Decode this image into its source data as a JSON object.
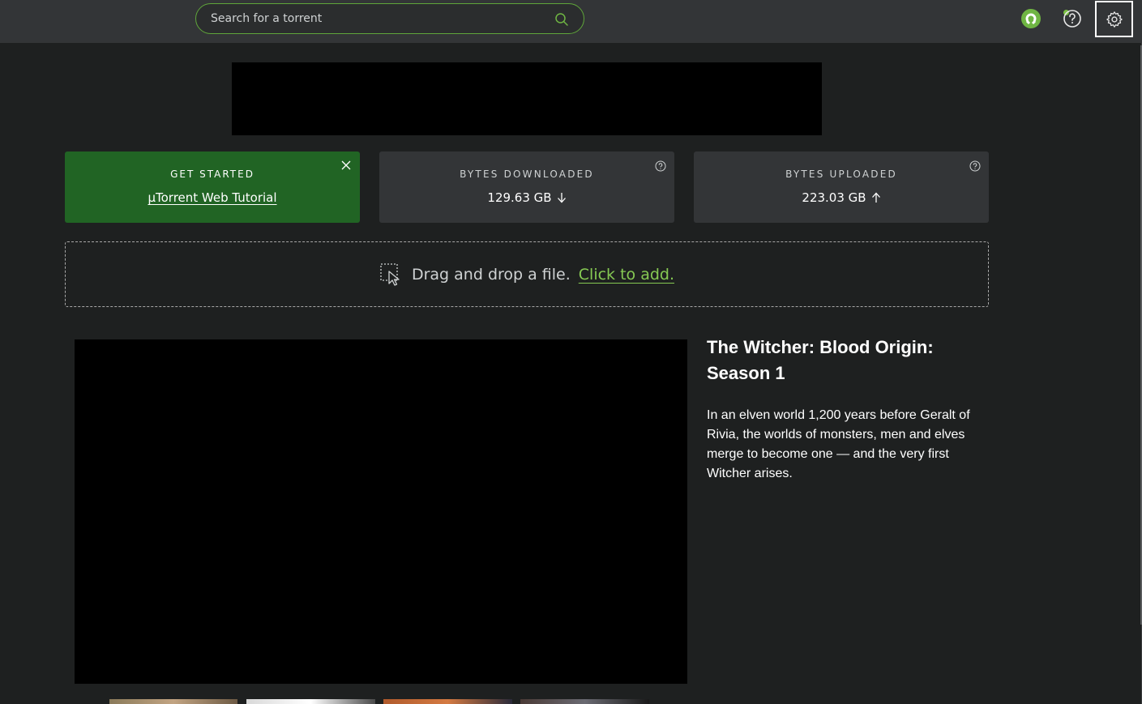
{
  "search": {
    "placeholder": "Search for a torrent"
  },
  "header": {
    "icons": [
      "magnet-icon",
      "help-icon",
      "settings-icon"
    ],
    "accent_color": "#7bc043"
  },
  "cards": {
    "get_started": {
      "label": "GET STARTED",
      "link": "µTorrent Web Tutorial"
    },
    "downloaded": {
      "label": "BYTES DOWNLOADED",
      "value": "129.63 GB"
    },
    "uploaded": {
      "label": "BYTES UPLOADED",
      "value": "223.03 GB"
    }
  },
  "dropzone": {
    "text": "Drag and drop a file.",
    "link": "Click to add."
  },
  "featured": {
    "title": "The Witcher: Blood Origin: Season 1",
    "description": "In an elven world 1,200 years before Geralt of Rivia, the worlds of monsters, men and elves merge to become one — and the very first Witcher arises."
  },
  "colors": {
    "brand_green": "#216424",
    "link_green": "#86c953",
    "panel": "#333537",
    "background": "#1e2020"
  }
}
